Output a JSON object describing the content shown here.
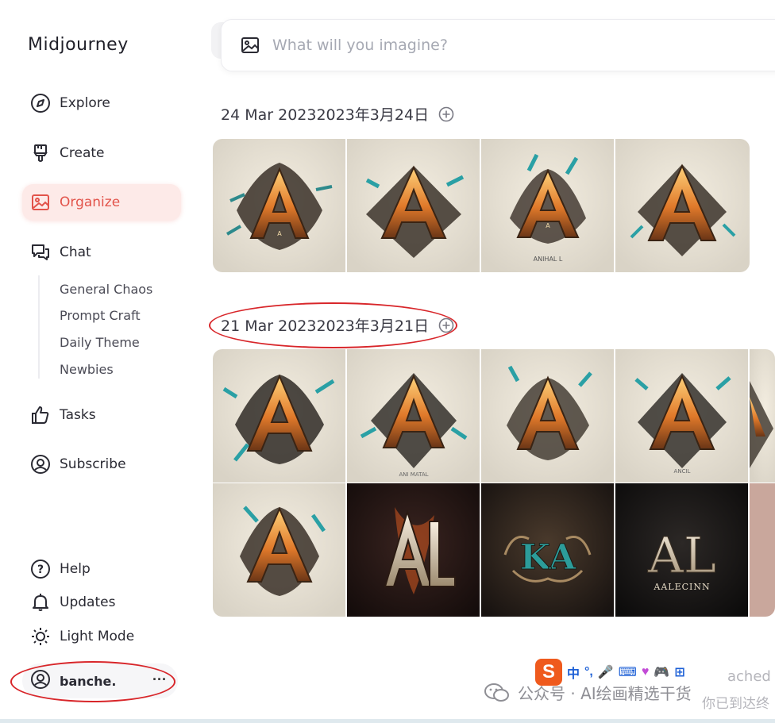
{
  "app": {
    "title": "Midjourney"
  },
  "nav": {
    "explore": "Explore",
    "create": "Create",
    "organize": "Organize",
    "chat": "Chat",
    "chat_channels": [
      "General Chaos",
      "Prompt Craft",
      "Daily Theme",
      "Newbies"
    ],
    "tasks": "Tasks",
    "subscribe": "Subscribe",
    "help": "Help",
    "updates": "Updates",
    "light_mode": "Light Mode"
  },
  "user": {
    "name": "banche.",
    "menu": "···"
  },
  "search": {
    "placeholder": "What will you imagine?"
  },
  "groups": [
    {
      "date": "24 Mar 20232023年3月24日"
    },
    {
      "date": "21 Mar 20232023年3月21日"
    }
  ],
  "tile_captions": {
    "t1_small": "A",
    "t3_small": "A",
    "t3_sub": "ANIHAL L",
    "t6_sub": "ANI MATAL",
    "t8_sub": "ANCIL",
    "t13_main": "AL",
    "t13_sub": "AALECINN",
    "t12_main": "KA"
  },
  "ime": {
    "logo": "S",
    "items": [
      "中",
      "°,",
      "🎤",
      "⌨",
      "♥",
      "🎮",
      "⊞"
    ]
  },
  "watermark": {
    "text": "公众号 · AI绘画精选干货"
  },
  "ghost": {
    "line1": "ached",
    "line2": "你已到达终"
  },
  "colors": {
    "accent": "#e2534a",
    "annotation": "#d8262a",
    "ime_logo": "#ef5a1d"
  }
}
